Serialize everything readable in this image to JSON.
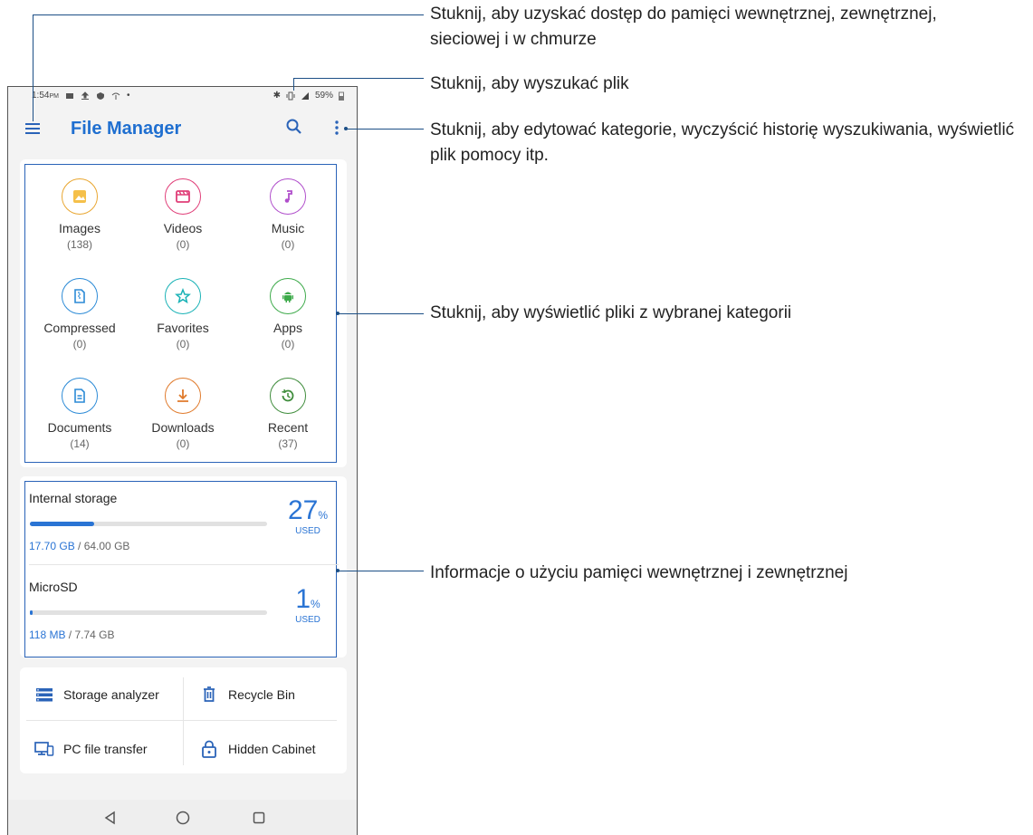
{
  "status_bar": {
    "time": "1:54",
    "ampm": "PM",
    "battery": "59%"
  },
  "app": {
    "title": "File Manager"
  },
  "categories": [
    {
      "label": "Images",
      "count": "(138)",
      "color": "#e9a630",
      "icon": "image-icon"
    },
    {
      "label": "Videos",
      "count": "(0)",
      "color": "#e03e78",
      "icon": "film-icon"
    },
    {
      "label": "Music",
      "count": "(0)",
      "color": "#b04ecb",
      "icon": "music-note-icon"
    },
    {
      "label": "Compressed",
      "count": "(0)",
      "color": "#2b8ad6",
      "icon": "zip-file-icon"
    },
    {
      "label": "Favorites",
      "count": "(0)",
      "color": "#19b2b6",
      "icon": "star-icon"
    },
    {
      "label": "Apps",
      "count": "(0)",
      "color": "#3daa4a",
      "icon": "android-icon"
    },
    {
      "label": "Documents",
      "count": "(14)",
      "color": "#2b8ad6",
      "icon": "document-icon"
    },
    {
      "label": "Downloads",
      "count": "(0)",
      "color": "#e07a2b",
      "icon": "download-icon"
    },
    {
      "label": "Recent",
      "count": "(37)",
      "color": "#3e8c3b",
      "icon": "history-icon"
    }
  ],
  "storage": {
    "internal": {
      "name": "Internal storage",
      "used": "17.70 GB",
      "total": " / 64.00 GB",
      "percent": "27",
      "percent_sign": "%",
      "used_label": "USED",
      "fraction": 0.27
    },
    "sd": {
      "name": "MicroSD",
      "used": "118 MB",
      "total": " / 7.74 GB",
      "percent": "1",
      "percent_sign": "%",
      "used_label": "USED",
      "fraction": 0.01
    }
  },
  "tools": {
    "storage_analyzer": "Storage analyzer",
    "recycle_bin": "Recycle Bin",
    "pc_transfer": "PC file transfer",
    "hidden_cabinet": "Hidden Cabinet"
  },
  "callouts": {
    "menu": "Stuknij, aby uzyskać dostęp do pamięci wewnętrznej, zewnętrznej, sieciowej i w chmurze",
    "search": "Stuknij, aby wyszukać plik",
    "more": "Stuknij, aby edytować kategorie, wyczyścić historię wyszukiwania, wyświetlić plik pomocy itp.",
    "categories": "Stuknij, aby wyświetlić pliki z wybranej kategorii",
    "storage": "Informacje o użyciu pamięci wewnętrznej i zewnętrznej"
  }
}
